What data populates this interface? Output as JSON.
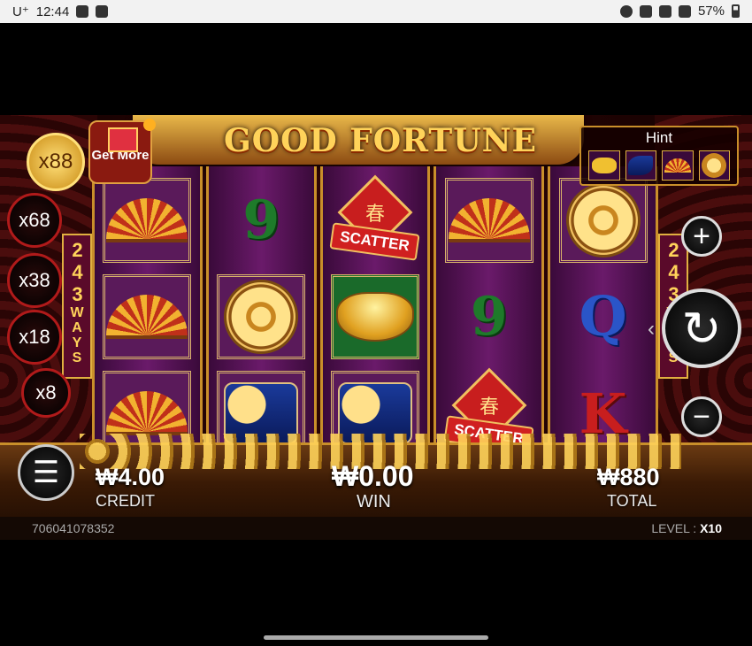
{
  "status_bar": {
    "carrier": "U⁺",
    "time": "12:44",
    "battery": "57%"
  },
  "game": {
    "title": "GOOD FORTUNE",
    "get_more": "Get More",
    "hint_label": "Hint",
    "ways_text": "243",
    "ways_label": "WAYS",
    "multipliers": [
      "x88",
      "x68",
      "x38",
      "x18",
      "x8"
    ],
    "active_multiplier": "x88",
    "reels": [
      [
        "fan",
        "fan",
        "fan"
      ],
      [
        "9",
        "coin-medal",
        "fish"
      ],
      [
        "scatter",
        "gold-ingot",
        "fish"
      ],
      [
        "fan",
        "9",
        "scatter"
      ],
      [
        "coin-medal",
        "Q",
        "K"
      ]
    ],
    "scatter_label": "SCATTER",
    "scatter_char": "春",
    "credit_amount": "₩4.00",
    "credit_label": "CREDIT",
    "win_amount": "₩0.00",
    "win_label": "WIN",
    "total_amount": "₩880",
    "total_label": "TOTAL",
    "game_id": "706041078352",
    "level_label": "LEVEL :",
    "level_value": "X10",
    "plus_label": "+",
    "minus_label": "−",
    "spin_icon": "↻",
    "menu_icon": "☰"
  }
}
